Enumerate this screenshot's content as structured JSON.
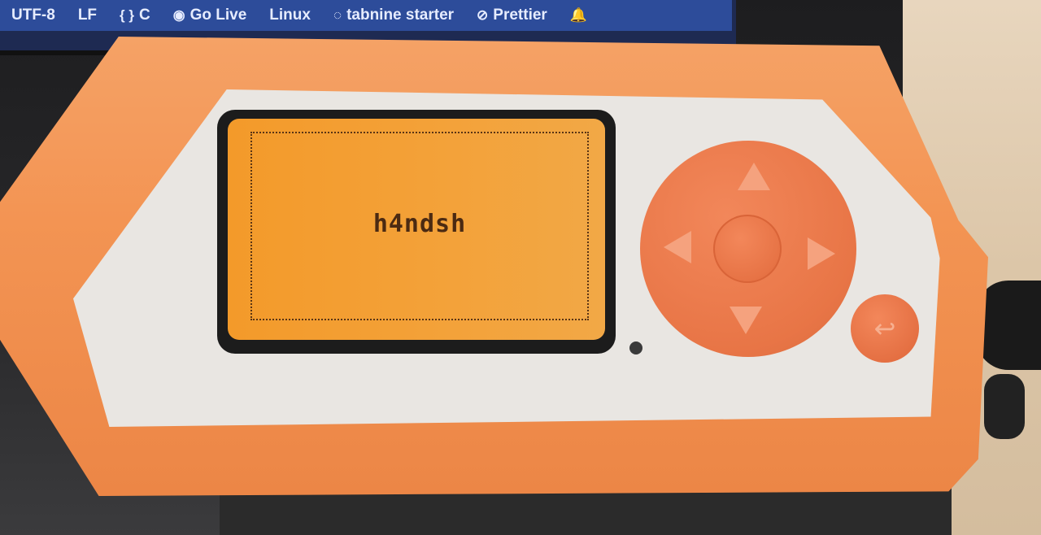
{
  "statusbar": {
    "items": [
      {
        "icon": "",
        "label": "UTF-8"
      },
      {
        "icon": "",
        "label": "LF"
      },
      {
        "icon": "{ }",
        "label": "C"
      },
      {
        "icon": "broadcast-icon",
        "label": "Go Live"
      },
      {
        "icon": "",
        "label": "Linux"
      },
      {
        "icon": "tabnine-icon",
        "label": "tabnine starter"
      },
      {
        "icon": "prettier-icon",
        "label": "Prettier"
      },
      {
        "icon": "bell-icon",
        "label": ""
      }
    ]
  },
  "device": {
    "lcd_text": "h4ndsh",
    "colors": {
      "shell": "#f39453",
      "lcd": "#f3a23a",
      "face": "#e9e6e2"
    }
  }
}
